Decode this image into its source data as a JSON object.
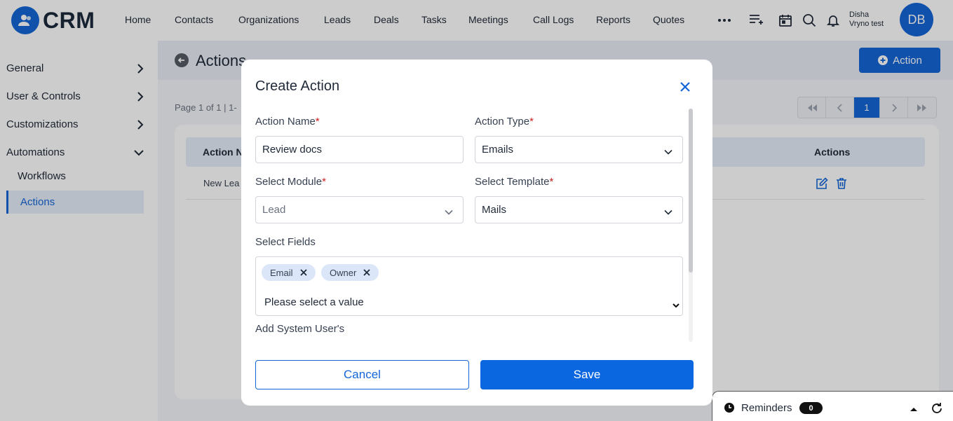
{
  "app": {
    "logo_text": "CRM"
  },
  "nav": {
    "items": [
      "Home",
      "Contacts",
      "Organizations",
      "Leads",
      "Deals",
      "Tasks",
      "Meetings",
      "Call Logs",
      "Reports",
      "Quotes"
    ]
  },
  "user": {
    "first_name": "Disha",
    "org": "Vryno test",
    "initials": "DB"
  },
  "sidebar": {
    "general": "General",
    "user_controls": "User & Controls",
    "customizations": "Customizations",
    "automations": "Automations",
    "workflows": "Workflows",
    "actions": "Actions"
  },
  "main": {
    "title": "Actions",
    "add_button": "Action",
    "page_info": "Page 1 of 1  |  1-",
    "current_page": "1",
    "table": {
      "col_name": "Action N",
      "col_actions": "Actions",
      "rows": [
        {
          "name": "New Lea"
        }
      ]
    }
  },
  "modal": {
    "title": "Create Action",
    "action_name_label": "Action Name",
    "action_name_value": "Review docs",
    "action_type_label": "Action Type",
    "action_type_value": "Emails",
    "select_module_label": "Select Module",
    "select_module_value": "Lead",
    "select_template_label": "Select Template",
    "select_template_value": "Mails",
    "select_fields_label": "Select Fields",
    "chips": [
      "Email",
      "Owner"
    ],
    "fields_placeholder": "Please select a value",
    "system_users_label": "Add System User's",
    "required_mark": "*",
    "cancel": "Cancel",
    "save": "Save"
  },
  "reminders": {
    "label": "Reminders",
    "count": "0"
  },
  "colors": {
    "primary": "#1466d8",
    "required": "#c81e1e",
    "chip": "#dbe7f8"
  }
}
